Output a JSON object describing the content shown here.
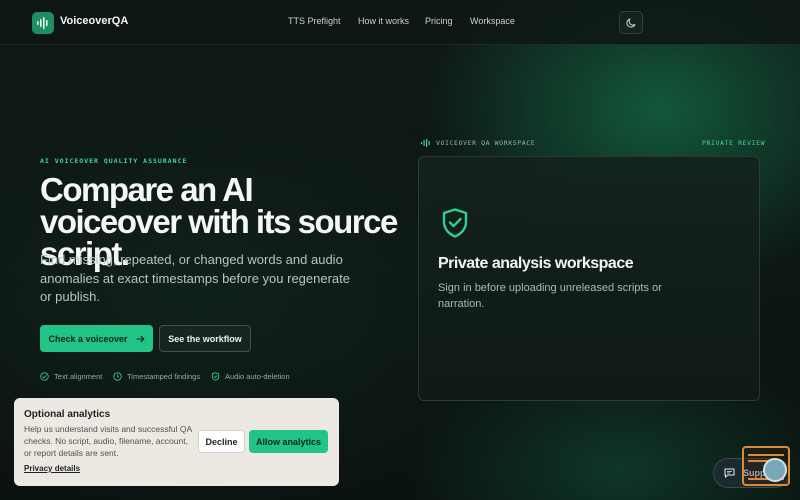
{
  "header": {
    "logo_text": "VoiceoverQA",
    "nav": [
      {
        "label": "TTS Preflight"
      },
      {
        "label": "How it works"
      },
      {
        "label": "Pricing"
      },
      {
        "label": "Workspace"
      }
    ]
  },
  "hero": {
    "eyebrow": "AI VOICEOVER QUALITY ASSURANCE",
    "title": "Compare an AI voiceover with its source script.",
    "subtitle": "Find missing, repeated, or changed words and audio anomalies at exact timestamps before you regenerate or publish.",
    "primary_cta": "Check a voiceover",
    "secondary_cta": "See the workflow",
    "features": [
      {
        "label": "Text alignment"
      },
      {
        "label": "Timestamped findings"
      },
      {
        "label": "Audio auto-deletion"
      }
    ]
  },
  "workspace": {
    "label": "VOICEOVER QA WORKSPACE",
    "badge": "PRIVATE REVIEW",
    "title": "Private analysis workspace",
    "description": "Sign in before uploading unreleased scripts or narration."
  },
  "cookie": {
    "title": "Optional analytics",
    "text": "Help us understand visits and successful QA checks. No script, audio, filename, account, or report details are sent.",
    "link": "Privacy details",
    "decline": "Decline",
    "allow": "Allow analytics"
  },
  "support": {
    "label": "Support"
  },
  "colors": {
    "accent": "#22c386",
    "background": "#0c1412"
  }
}
